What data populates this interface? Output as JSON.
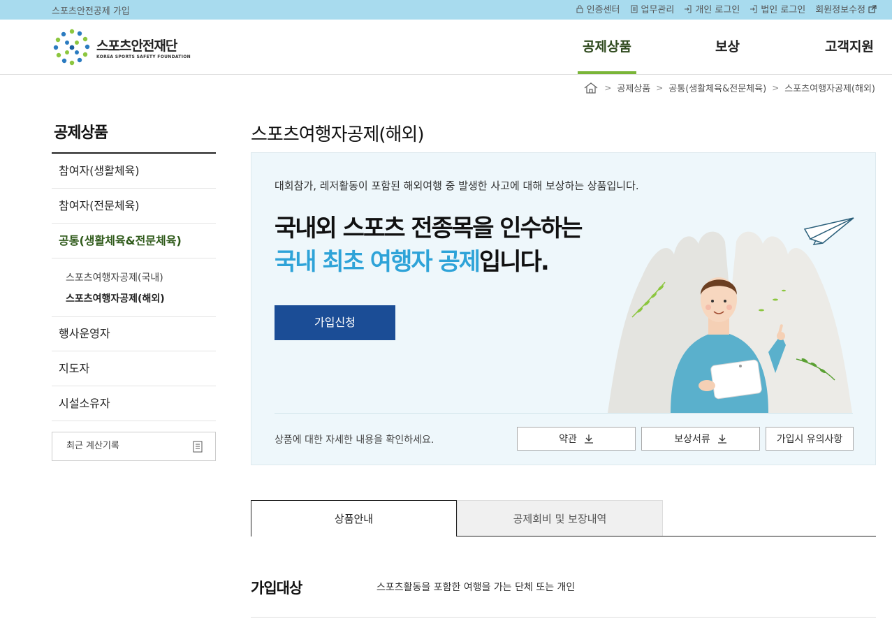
{
  "topbar": {
    "join": "스포츠안전공제 가입",
    "links": [
      "인증센터",
      "업무관리",
      "개인 로그인",
      "법인 로그인",
      "회원정보수정"
    ]
  },
  "logo": {
    "name_ko": "스포츠안전재단",
    "name_en": "KOREA SPORTS SAFETY FOUNDATION"
  },
  "gnb": [
    "공제상품",
    "보상",
    "고객지원"
  ],
  "breadcrumb": [
    "공제상품",
    "공통(생활체육&전문체육)",
    "스포츠여행자공제(해외)"
  ],
  "sidebar": {
    "title": "공제상품",
    "items": [
      "참여자(생활체육)",
      "참여자(전문체육)",
      "공통(생활체육&전문체육)",
      "행사운영자",
      "지도자",
      "시설소유자"
    ],
    "subitems": [
      "스포츠여행자공제(국내)",
      "스포츠여행자공제(해외)"
    ],
    "recent": "최근 계산기록"
  },
  "main": {
    "title": "스포츠여행자공제(해외)",
    "desc": "대회참가, 레저활동이 포함된 해외여행 중 발생한 사고에 대해 보상하는 상품입니다.",
    "headline1": "국내외 스포츠 전종목을 인수하는",
    "headline2_hl": "국내 최초 여행자 공제",
    "headline2_rest": "입니다.",
    "join_button": "가입신청",
    "info": "상품에 대한 자세한 내용을 확인하세요.",
    "doc_buttons": [
      "약관",
      "보상서류",
      "가입시 유의사항"
    ]
  },
  "tabs": [
    "상품안내",
    "공제회비 및 보장내역"
  ],
  "section": {
    "label": "가입대상",
    "value": "스포츠활동을 포함한 여행을 가는 단체 또는 개인"
  },
  "colors": {
    "topbar": "#a8dbee",
    "accent_green": "#7ab538",
    "primary_blue": "#1b4d96",
    "highlight": "#2ea3d8"
  }
}
